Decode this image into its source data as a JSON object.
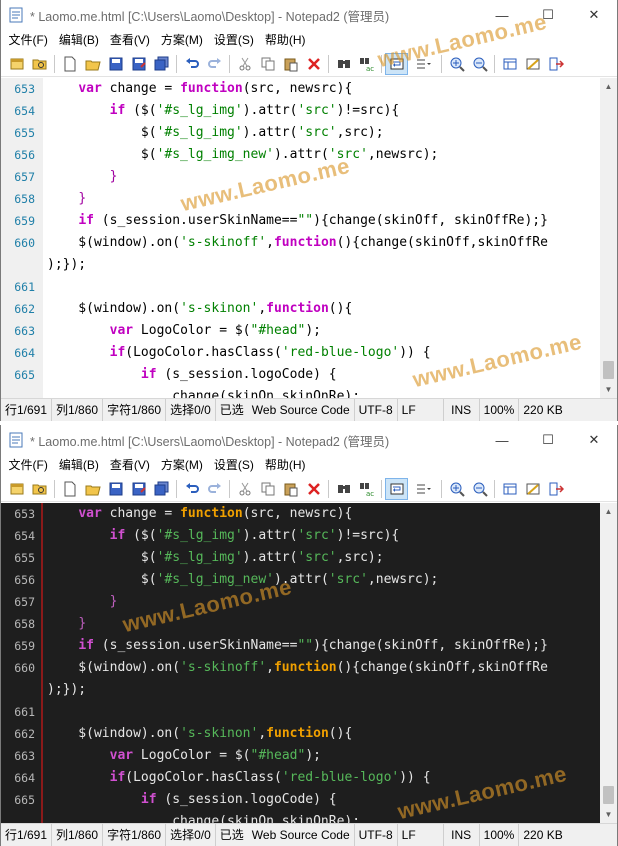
{
  "window": {
    "title": "* Laomo.me.html [C:\\Users\\Laomo\\Desktop] - Notepad2 (管理员)",
    "minimize_glyph": "—",
    "maximize_glyph": "☐",
    "close_glyph": "✕"
  },
  "menu": [
    "文件(F)",
    "编辑(B)",
    "查看(V)",
    "方案(M)",
    "设置(S)",
    "帮助(H)"
  ],
  "toolbar_icons": [
    "new-window-icon",
    "open-folder-icon",
    "new-file-icon",
    "open-file-icon",
    "save-icon",
    "save-as-icon",
    "save-all-icon",
    "undo-icon",
    "redo-icon",
    "cut-icon",
    "copy-icon",
    "paste-icon",
    "delete-icon",
    "find-icon",
    "replace-icon",
    "word-wrap-icon",
    "more-icon",
    "zoom-in-icon",
    "zoom-out-icon",
    "scheme-icon",
    "settings-icon",
    "exit-icon"
  ],
  "gutter": [
    "653",
    "654",
    "655",
    "656",
    "657",
    "658",
    "659",
    "660",
    "",
    "661",
    "662",
    "663",
    "664",
    "665",
    ""
  ],
  "code": [
    [
      [
        "    ",
        "n"
      ],
      [
        "var",
        "kw"
      ],
      [
        " change = ",
        "n"
      ],
      [
        "function",
        "fn"
      ],
      [
        "(src, newsrc){",
        "n"
      ]
    ],
    [
      [
        "        ",
        "n"
      ],
      [
        "if",
        "kw"
      ],
      [
        " ($(",
        "n"
      ],
      [
        "'#s_lg_img'",
        "str"
      ],
      [
        ").attr(",
        "n"
      ],
      [
        "'src'",
        "str"
      ],
      [
        ")!=src){",
        "n"
      ]
    ],
    [
      [
        "            $(",
        "n"
      ],
      [
        "'#s_lg_img'",
        "str"
      ],
      [
        ").attr(",
        "n"
      ],
      [
        "'src'",
        "str"
      ],
      [
        ",src);",
        "n"
      ]
    ],
    [
      [
        "            $(",
        "n"
      ],
      [
        "'#s_lg_img_new'",
        "str"
      ],
      [
        ").attr(",
        "n"
      ],
      [
        "'src'",
        "str"
      ],
      [
        ",newsrc);",
        "n"
      ]
    ],
    [
      [
        "        ",
        "n"
      ],
      [
        "}",
        "br"
      ]
    ],
    [
      [
        "    ",
        "n"
      ],
      [
        "}",
        "br"
      ]
    ],
    [
      [
        "    ",
        "n"
      ],
      [
        "if",
        "kw"
      ],
      [
        " (s_session.userSkinName==",
        "n"
      ],
      [
        "\"\"",
        "str"
      ],
      [
        "){change(skinOff, skinOffRe);}",
        "n"
      ]
    ],
    [
      [
        "    $(window).on(",
        "n"
      ],
      [
        "'s-skinoff'",
        "str"
      ],
      [
        ",",
        "n"
      ],
      [
        "function",
        "fn"
      ],
      [
        "(){change(skinOff,skinOffRe",
        "n"
      ]
    ],
    [
      [
        ");});",
        "n"
      ]
    ],
    [
      [
        "",
        "n"
      ]
    ],
    [
      [
        "    $(window).on(",
        "n"
      ],
      [
        "'s-skinon'",
        "str"
      ],
      [
        ",",
        "n"
      ],
      [
        "function",
        "fn"
      ],
      [
        "(){",
        "n"
      ]
    ],
    [
      [
        "        ",
        "n"
      ],
      [
        "var",
        "kw"
      ],
      [
        " LogoColor = $(",
        "n"
      ],
      [
        "\"#head\"",
        "str"
      ],
      [
        ");",
        "n"
      ]
    ],
    [
      [
        "        ",
        "n"
      ],
      [
        "if",
        "kw"
      ],
      [
        "(LogoColor.hasClass(",
        "n"
      ],
      [
        "'red-blue-logo'",
        "str"
      ],
      [
        ")) {",
        "n"
      ]
    ],
    [
      [
        "            ",
        "n"
      ],
      [
        "if",
        "kw"
      ],
      [
        " (s_session.logoCode) {",
        "n"
      ]
    ],
    [
      [
        "                change(skinOn,skinOnRe);",
        "n"
      ]
    ]
  ],
  "status": {
    "line": "行1/691",
    "col": "列1/860",
    "char": "字符1/860",
    "sel": "选择0/0",
    "selected": "已选",
    "scheme": "Web Source Code",
    "encoding": "UTF-8",
    "eol": "LF",
    "ins": "INS",
    "zoom": "100%",
    "size": "220 KB"
  },
  "watermark": "www.Laomo.me",
  "colors": {
    "light_keyword": "#c000c0",
    "light_string": "#008000",
    "dark_background": "#1e1e1e",
    "dark_function": "#f0a000",
    "dark_string": "#56b85a",
    "dark_margin": "#8b1a1a",
    "watermark": "#da9628"
  }
}
